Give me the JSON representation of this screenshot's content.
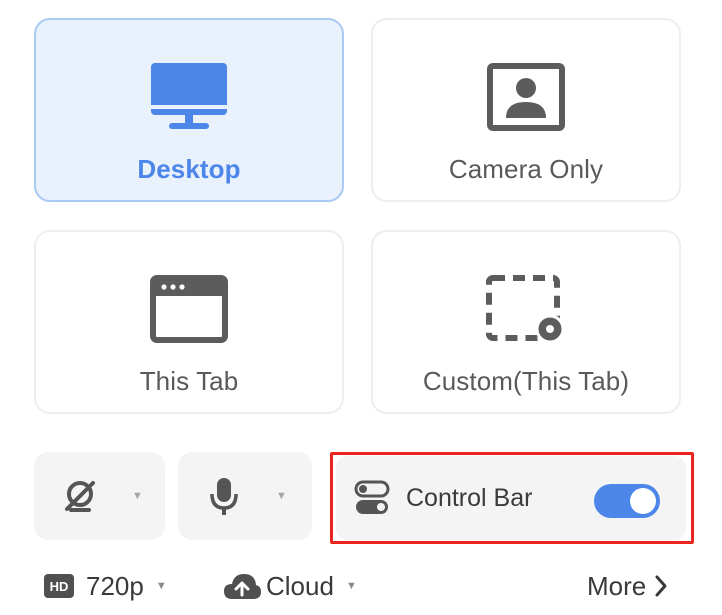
{
  "modes": {
    "desktop": {
      "label": "Desktop",
      "icon": "monitor-icon",
      "selected": true
    },
    "camera_only": {
      "label": "Camera Only",
      "icon": "camera-portrait-icon",
      "selected": false
    },
    "this_tab": {
      "label": "This Tab",
      "icon": "browser-window-icon",
      "selected": false
    },
    "custom_this_tab": {
      "label": "Custom(This Tab)",
      "icon": "custom-region-icon",
      "selected": false
    }
  },
  "controls": {
    "camera": {
      "icon": "camera-off-icon",
      "dropdown_icon": "caret-down-icon"
    },
    "microphone": {
      "icon": "microphone-icon",
      "dropdown_icon": "caret-down-icon"
    },
    "control_bar": {
      "label": "Control Bar",
      "icon": "toggle-settings-icon",
      "enabled": true
    }
  },
  "footer": {
    "quality": {
      "badge": "HD",
      "value": "720p"
    },
    "storage": {
      "value": "Cloud",
      "icon": "cloud-upload-icon"
    },
    "more": {
      "label": "More"
    }
  },
  "colors": {
    "accent": "#4b86e8",
    "selected_bg": "#e9f1fd",
    "highlight_border": "#e8261d"
  }
}
